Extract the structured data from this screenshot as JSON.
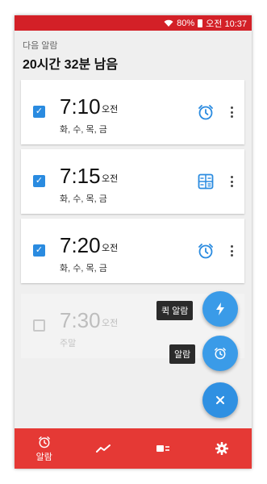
{
  "status_bar": {
    "battery": "80%",
    "time": "오전 10:37"
  },
  "header": {
    "next_label": "다음 알람",
    "remaining": "20시간 32분 남음"
  },
  "alarms": [
    {
      "time": "7:10",
      "ampm": "오전",
      "days": "화, 수, 목, 금",
      "enabled": true,
      "icon": "alarm-clock-icon"
    },
    {
      "time": "7:15",
      "ampm": "오전",
      "days": "화, 수, 목, 금",
      "enabled": true,
      "icon": "calculator-icon"
    },
    {
      "time": "7:20",
      "ampm": "오전",
      "days": "화, 수, 목, 금",
      "enabled": true,
      "icon": "alarm-clock-icon"
    },
    {
      "time": "7:30",
      "ampm": "오전",
      "days": "주말",
      "enabled": false,
      "icon": "alarm-clock-icon"
    }
  ],
  "fab_menu": {
    "quick_alarm_label": "퀵 알람",
    "alarm_label": "알람"
  },
  "bottom_nav": {
    "alarm_label": "알람"
  },
  "colors": {
    "accent": "#2f90e2",
    "bar": "#e53935"
  }
}
